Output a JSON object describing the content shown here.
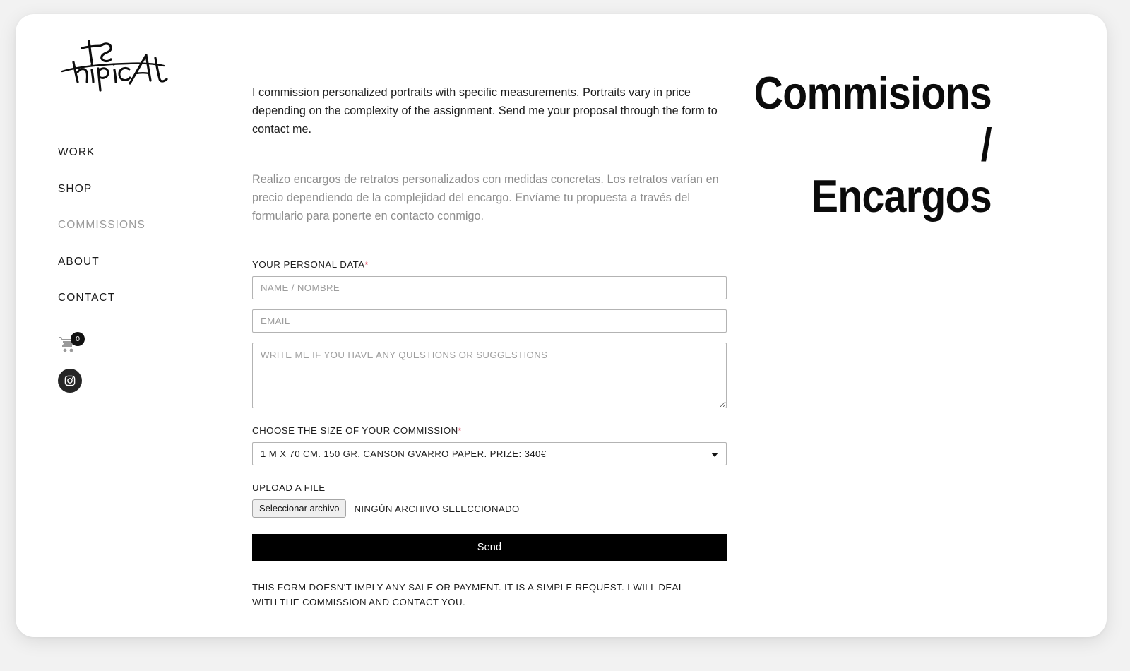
{
  "brand": {
    "logo_alt": "tipical-signature-logo"
  },
  "sidebar": {
    "items": [
      {
        "label": "WORK",
        "active": false
      },
      {
        "label": "SHOP",
        "active": false
      },
      {
        "label": "COMMISSIONS",
        "active": true
      },
      {
        "label": "ABOUT",
        "active": false
      },
      {
        "label": "CONTACT",
        "active": false
      }
    ],
    "cart": {
      "icon": "shopping-cart-icon",
      "count": "0"
    },
    "social": {
      "icon": "instagram-icon"
    }
  },
  "heading": {
    "line1": "Commisions",
    "line2": "/",
    "line3": "Encargos"
  },
  "main": {
    "intro_en": "I commission personalized portraits with specific measurements. Portraits vary in price depending on the complexity of the assignment. Send me your proposal through the form to contact me.",
    "intro_es": "Realizo encargos de retratos personalizados con medidas concretas. Los retratos varían en precio dependiendo de la complejidad del encargo. Envíame tu propuesta a través del formulario para ponerte en contacto conmigo."
  },
  "form": {
    "personal_data_label": "YOUR PERSONAL DATA",
    "required_mark": "*",
    "name_placeholder": "NAME / NOMBRE",
    "name_value": "",
    "email_placeholder": "EMAIL",
    "email_value": "",
    "message_placeholder": "WRITE ME IF YOU HAVE ANY QUESTIONS OR SUGGESTIONS",
    "message_value": "",
    "size_label": "CHOOSE THE SIZE OF YOUR COMMISSION",
    "size_selected": "1 M X 70 CM. 150 GR. CANSON GVARRO PAPER. PRIZE: 340€",
    "size_options": [
      "1 M X 70 CM. 150 GR. CANSON GVARRO PAPER. PRIZE: 340€"
    ],
    "upload_label": "UPLOAD A FILE",
    "file_button_label": "Seleccionar archivo",
    "file_status": "NINGÚN ARCHIVO SELECCIONADO",
    "submit_label": "Send",
    "disclaimer": "THIS FORM DOESN'T IMPLY ANY SALE OR PAYMENT. IT IS A SIMPLE REQUEST. I WILL DEAL WITH THE COMMISSION AND CONTACT YOU."
  },
  "colors": {
    "accent_required": "#e0304b",
    "text": "#1d1d1d",
    "muted": "#8d8d8d",
    "nav_active": "#9b9b9b",
    "button_bg": "#000000",
    "page_bg": "#f2f2f2",
    "card_bg": "#ffffff"
  }
}
